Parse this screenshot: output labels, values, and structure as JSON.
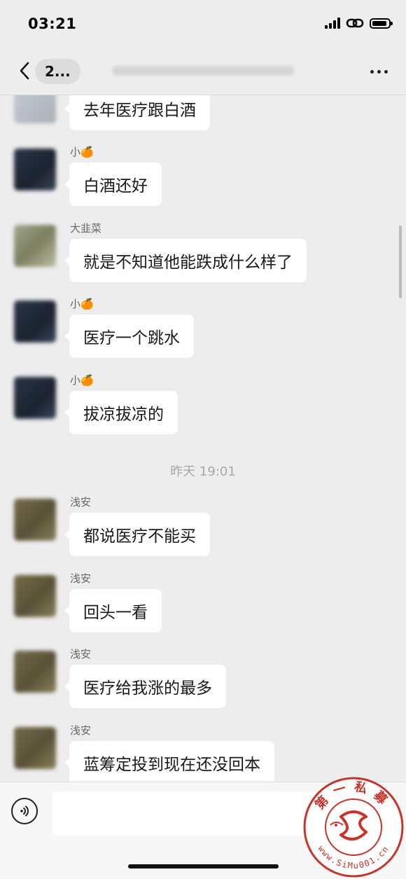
{
  "status_bar": {
    "time": "03:21"
  },
  "nav": {
    "back_label": "2..."
  },
  "messages": [
    {
      "sender": "",
      "text": "去年医疗跟白酒",
      "avatar": "pale"
    },
    {
      "sender": "小🍊",
      "text": "白酒还好",
      "avatar": "navy"
    },
    {
      "sender": "大韭菜",
      "text": "就是不知道他能跌成什么样了",
      "avatar": "khaki"
    },
    {
      "sender": "小🍊",
      "text": "医疗一个跳水",
      "avatar": "navy"
    },
    {
      "sender": "小🍊",
      "text": "拔凉拔凉的",
      "avatar": "navy"
    },
    {
      "sender": "浅安",
      "text": "都说医疗不能买",
      "avatar": "olive"
    },
    {
      "sender": "浅安",
      "text": "回头一看",
      "avatar": "olive"
    },
    {
      "sender": "浅安",
      "text": "医疗给我涨的最多",
      "avatar": "olive"
    },
    {
      "sender": "浅安",
      "text": "蓝筹定投到现在还没回本",
      "avatar": "olive"
    }
  ],
  "timestamp": "昨天 19:01",
  "watermark": {
    "top_text": "第一私募",
    "bottom_text": "www.SiMu001.cn"
  },
  "colors": {
    "background": "#ededed",
    "bubble": "#ffffff",
    "watermark": "#c8332a"
  }
}
